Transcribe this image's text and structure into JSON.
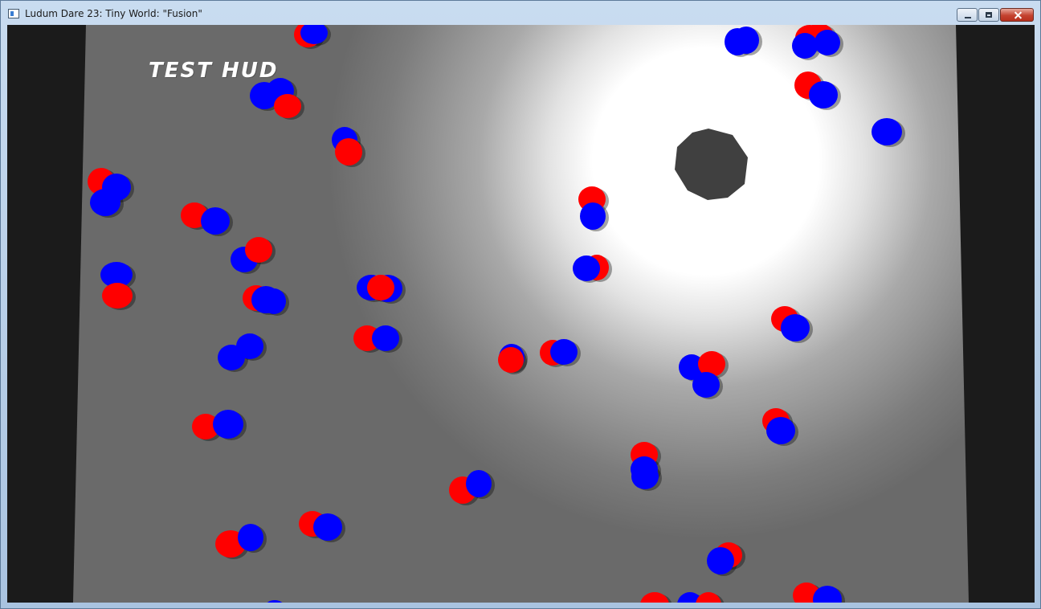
{
  "window": {
    "title": "Ludum Dare 23: Tiny World: \"Fusion\"",
    "buttons": [
      "minimize",
      "maximize",
      "close"
    ]
  },
  "hud": {
    "text": "TEST HUD"
  },
  "colors": {
    "particle_red": "#ff0000",
    "particle_blue": "#0000ff",
    "core": "#404040",
    "floor": "#6e6e6e",
    "background": "#1b1b1b",
    "glow": "#ffffff"
  },
  "icons": {
    "app": "app-window-icon",
    "minimize": "minimize-icon",
    "maximize": "maximize-icon",
    "close": "close-icon"
  }
}
